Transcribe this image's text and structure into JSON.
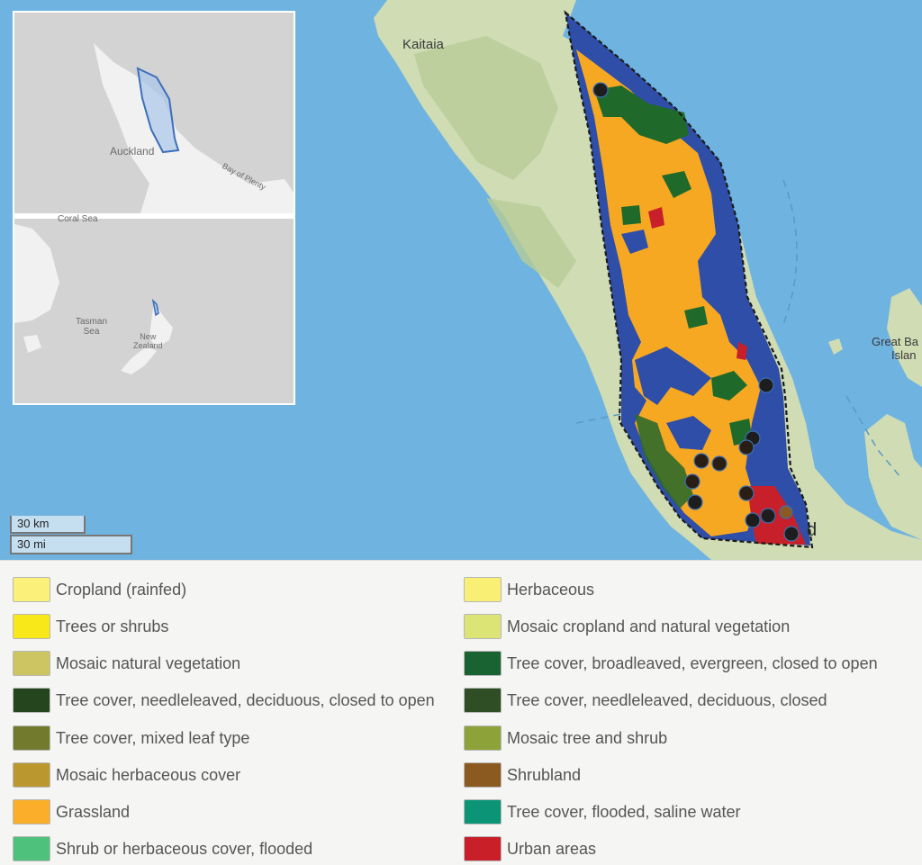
{
  "map": {
    "labels": {
      "kaitaia": "Kaitaia",
      "great_barrier": "Great Ba",
      "great_barrier_2": "Islan",
      "auckland_partial": "d"
    },
    "colors": {
      "sea": "#6fb3e0",
      "land": "#cfdcb4",
      "land_dark": "#a9c38f",
      "study_water": "#2f4ea8",
      "grassland": "#f7a823",
      "forest": "#1f6a2a",
      "urban": "#c8202a",
      "boundary": "#1a1a1a"
    },
    "site_markers": {
      "count": 16,
      "color": "#1d1d1d"
    }
  },
  "inset": {
    "top": {
      "labels": {
        "auckland": "Auckland",
        "bay_of_plenty": "Bay of Plenty"
      }
    },
    "bottom": {
      "labels": {
        "coral_sea": "Coral Sea",
        "tasman_sea": "Tasman\nSea",
        "new_zealand": "New\nZealand"
      }
    }
  },
  "scale": {
    "km": "30 km",
    "mi": "30 mi"
  },
  "legend": {
    "left": [
      {
        "label": "Cropland (rainfed)",
        "color": "#fbf079"
      },
      {
        "label": "Trees or shrubs",
        "color": "#f8e81a"
      },
      {
        "label": "Mosaic natural vegetation",
        "color": "#cdc562"
      },
      {
        "label": "Tree cover, needleleaved, deciduous, closed to open",
        "color": "#25451f"
      },
      {
        "label": "Tree cover, mixed leaf type",
        "color": "#717a2d"
      },
      {
        "label": "Mosaic herbaceous cover",
        "color": "#bb9730"
      },
      {
        "label": "Grassland",
        "color": "#fbae2a"
      },
      {
        "label": "Shrub or herbaceous cover, flooded",
        "color": "#4ec27c"
      }
    ],
    "right": [
      {
        "label": "Herbaceous",
        "color": "#f9ef74"
      },
      {
        "label": "Mosaic cropland and natural vegetation",
        "color": "#dde476"
      },
      {
        "label": "Tree cover, broadleaved, evergreen, closed to open",
        "color": "#196232"
      },
      {
        "label": "Tree cover, needleleaved, deciduous, closed",
        "color": "#2f4e26"
      },
      {
        "label": "Mosaic tree and shrub",
        "color": "#8ea23a"
      },
      {
        "label": "Shrubland",
        "color": "#8b5a20"
      },
      {
        "label": "Tree cover, flooded, saline water",
        "color": "#0c9476"
      },
      {
        "label": "Urban areas",
        "color": "#c81f28"
      }
    ]
  }
}
